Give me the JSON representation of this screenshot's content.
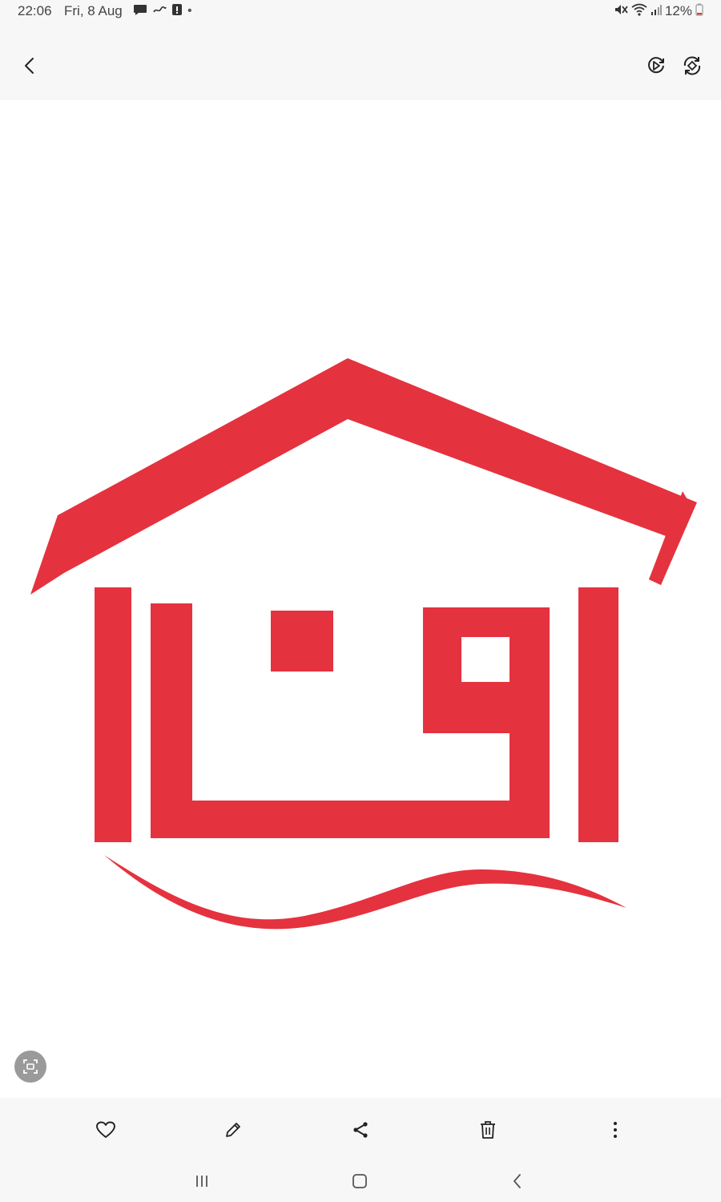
{
  "status_bar": {
    "time": "22:06",
    "date": "Fri, 8 Aug",
    "battery_percent": "12%",
    "notification_icons": [
      "chat-bubble-icon",
      "app-notification-icon",
      "alert-icon"
    ],
    "more_indicator": "•",
    "system_icons": [
      "mute-icon",
      "wifi-icon",
      "signal-icon",
      "battery-icon"
    ]
  },
  "top_bar": {
    "actions": [
      "back-icon",
      "video-playback-icon",
      "remaster-icon"
    ]
  },
  "image": {
    "subject": "red house logo",
    "logo_text": "اوقا",
    "logo_color": "#e5323f"
  },
  "bottom_toolbar": {
    "actions": [
      "favorite-icon",
      "edit-icon",
      "share-icon",
      "delete-icon",
      "more-icon"
    ]
  },
  "nav_bar": {
    "buttons": [
      "recent-apps-icon",
      "home-icon",
      "back-nav-icon"
    ]
  },
  "colors": {
    "chrome_background": "#f7f7f7",
    "icon_color": "#222222",
    "status_text": "#444444",
    "logo_red": "#e5323f"
  }
}
